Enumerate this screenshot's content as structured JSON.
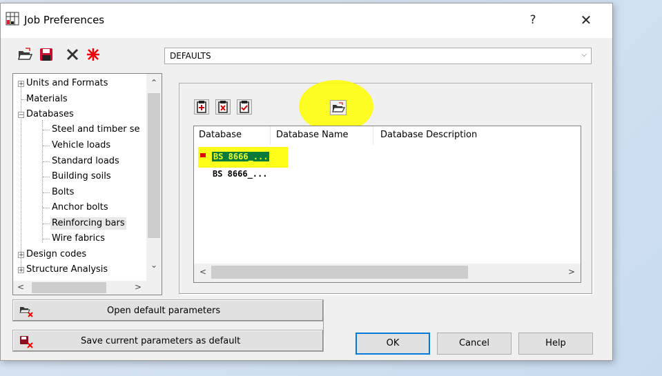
{
  "window": {
    "title": "Job Preferences",
    "help_glyph": "?",
    "close_glyph": "✕"
  },
  "toolbar": {
    "icons": [
      "open-folder-icon",
      "save-disk-icon",
      "delete-x-icon",
      "red-star-icon"
    ],
    "combo_value": "DEFAULTS"
  },
  "tree": {
    "items": [
      {
        "label": "Units and Formats",
        "level": 0,
        "expander": "+"
      },
      {
        "label": "Materials",
        "level": 0,
        "expander": ""
      },
      {
        "label": "Databases",
        "level": 0,
        "expander": "-"
      },
      {
        "label": "Steel and timber se",
        "level": 1
      },
      {
        "label": "Vehicle loads",
        "level": 1
      },
      {
        "label": "Standard loads",
        "level": 1
      },
      {
        "label": "Building soils",
        "level": 1
      },
      {
        "label": "Bolts",
        "level": 1
      },
      {
        "label": "Anchor bolts",
        "level": 1
      },
      {
        "label": "Reinforcing bars",
        "level": 1,
        "selected": true
      },
      {
        "label": "Wire fabrics",
        "level": 1
      },
      {
        "label": "Design codes",
        "level": 0,
        "expander": "+"
      },
      {
        "label": "Structure Analysis",
        "level": 0,
        "expander": "+"
      }
    ]
  },
  "database_panel": {
    "buttons": [
      "add-database-icon",
      "remove-database-icon",
      "check-database-icon",
      "open-folder-icon"
    ],
    "columns": [
      "Database",
      "Database Name",
      "Database Description"
    ],
    "rows": [
      {
        "database": "BS 8666_...",
        "selected": true
      },
      {
        "database": "BS 8666_...",
        "selected": false
      }
    ]
  },
  "actions": {
    "open_default": "Open default parameters",
    "save_default": "Save current parameters as default",
    "ok": "OK",
    "cancel": "Cancel",
    "help": "Help"
  },
  "colors": {
    "accent": "#0078d7",
    "highlight": "#ffff00",
    "selection_bg": "#0a7a3a"
  }
}
